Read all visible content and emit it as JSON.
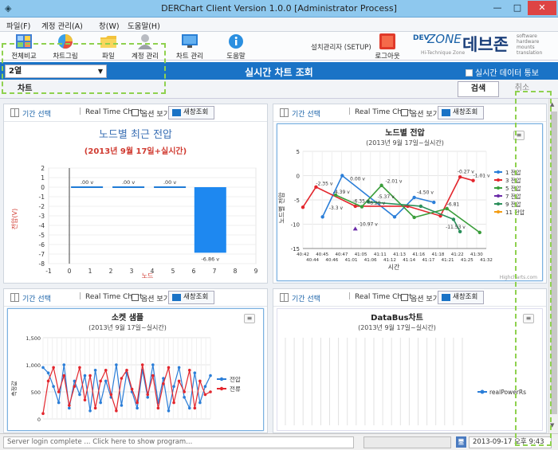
{
  "window": {
    "title": "DERChart Client Version 1.0.0 [Administrator Process]",
    "min": "—",
    "max": "□",
    "close": "✕"
  },
  "menu": [
    "파일(F)",
    "계정 관리(A)",
    "창(W)",
    "도움말(H)"
  ],
  "toolbar": {
    "items": [
      {
        "label": "전체비교",
        "icon": "grid-icon"
      },
      {
        "label": "차트그림",
        "icon": "pie-chart-icon"
      },
      {
        "label": "파일",
        "icon": "folder-icon"
      },
      {
        "label": "계정 관리",
        "icon": "user-icon"
      },
      {
        "label": "차트 관리",
        "icon": "monitor-icon"
      },
      {
        "label": "도움말",
        "icon": "info-icon"
      }
    ],
    "setup_label": "설치관리자 (SETUP)",
    "logout_label": "로그아웃"
  },
  "logo": {
    "dev": "DEV",
    "zone": "ZONE",
    "korean": "데브존",
    "tag": [
      "software",
      "hardware",
      "mounts",
      "translation"
    ],
    "sub": "Hi-Technique Zone"
  },
  "bar": {
    "combo_value": "2열",
    "title": "실시간 차트 조회",
    "realtime_check": "실시간 데이터 통보"
  },
  "subbar": {
    "chart_tab": "차트",
    "search": "검색",
    "cancel": "취소"
  },
  "panel_tools": {
    "range": "기간 선택",
    "sep": "|",
    "realtime": "Real Time Chart",
    "option": "옵션 보기",
    "new_window": "새창조회"
  },
  "charts": {
    "c1": {
      "title": "노드별 최근 전압",
      "subtitle": "(2013년 9월 17일+실시간)",
      "xlabel": "노드",
      "ylabel": "전압(V)",
      "xticks": [
        "-1",
        "0",
        "1",
        "2",
        "3",
        "4",
        "5",
        "6",
        "7",
        "8",
        "9"
      ],
      "yticks": [
        "2",
        "1",
        "0",
        "-1",
        "-2",
        "-3",
        "-4",
        "-5",
        "-6",
        "-7",
        "-8"
      ],
      "bar_labels": [
        ".00 v",
        ".00 v",
        ".00 v",
        ".00 v",
        "-6.86 v"
      ]
    },
    "c2": {
      "title": "노드별 전압",
      "subtitle": "(2013년 9월 17일~실시간)",
      "xlabel": "시간",
      "ylabel": "노드별 전압",
      "yticks": [
        "5",
        "0",
        "-5",
        "-10",
        "-15"
      ],
      "xticks_top": [
        "40:42",
        "40:45",
        "40:47",
        "41:05",
        "41:11",
        "41:13",
        "41:16",
        "41:18",
        "41:22",
        "41:30"
      ],
      "xticks_bottom": [
        "40:44",
        "40:46",
        "41:01",
        "41:06",
        "41:12",
        "41:14",
        "41:17",
        "41:21",
        "41:25",
        "41:32"
      ],
      "legend": [
        "1 전압",
        "3 전압",
        "5 전압",
        "7 전압",
        "9 전압",
        "11 전압"
      ],
      "annotations": [
        "-2.35 v",
        "0.00 v",
        "-3.3 v",
        "-4.39 v",
        "-6.35 v",
        "-5.37 v",
        "-6.29 v",
        "-2.01 v",
        "-4.50 v",
        "-6.81",
        "-0.27 v",
        "-1.01 v",
        "-10.97 v",
        "-11.53 v"
      ],
      "credit": "Highcharts.com"
    },
    "c3": {
      "title": "소켓 샘플",
      "subtitle": "(2013년 9월 17일~실시간)",
      "ylabel": "측정값",
      "yticks": [
        "1,500",
        "1,000",
        "500",
        "0"
      ],
      "legend": [
        "전압",
        "전류"
      ]
    },
    "c4": {
      "title": "DataBus차트",
      "subtitle": "(2013년 9월 17일~실시간)",
      "legend": [
        "realPowerRs"
      ]
    }
  },
  "chart_data": [
    {
      "type": "bar",
      "title": "노드별 최근 전압",
      "categories": [
        "1",
        "3",
        "5",
        "7"
      ],
      "values": [
        0,
        0,
        0,
        -6.86
      ],
      "xlabel": "노드",
      "ylabel": "전압(V)",
      "xlim": [
        -1,
        9
      ],
      "ylim": [
        -8,
        2
      ]
    },
    {
      "type": "line",
      "title": "노드별 전압",
      "series": [
        {
          "name": "1 전압",
          "color": "#2b7ed8",
          "points": [
            [
              1.5,
              -8.5
            ],
            [
              3,
              0
            ],
            [
              7,
              -8.5
            ],
            [
              8.5,
              -4.5
            ],
            [
              10,
              -5.5
            ]
          ]
        },
        {
          "name": "3 전압",
          "color": "#e3262d",
          "points": [
            [
              0,
              -6.5
            ],
            [
              1,
              -2.35
            ],
            [
              4,
              -6.3
            ],
            [
              8,
              -6.3
            ],
            [
              10.5,
              -8.3
            ],
            [
              12,
              -0.27
            ],
            [
              13,
              -1.01
            ]
          ]
        },
        {
          "name": "5 전압",
          "color": "#3a9d3a",
          "points": [
            [
              2.5,
              -4
            ],
            [
              4.5,
              -6.4
            ],
            [
              6,
              -2.01
            ],
            [
              8.5,
              -8.6
            ],
            [
              11,
              -6.8
            ],
            [
              13.5,
              -11.7
            ]
          ]
        },
        {
          "name": "7 전압",
          "color": "#6a2aa8",
          "points": [
            [
              4,
              -10.97
            ]
          ]
        },
        {
          "name": "9 전압",
          "color": "#2a8f5a",
          "points": [
            [
              5,
              -5.4
            ],
            [
              9,
              -6.3
            ],
            [
              11.5,
              -9
            ],
            [
              12,
              -11.53
            ]
          ]
        }
      ],
      "ylim": [
        -15,
        5
      ]
    }
  ],
  "status": {
    "message": "Server login complete ... Click here to show program...",
    "time": "2013-09-17 오후 9:43",
    "icon": "🖥"
  }
}
